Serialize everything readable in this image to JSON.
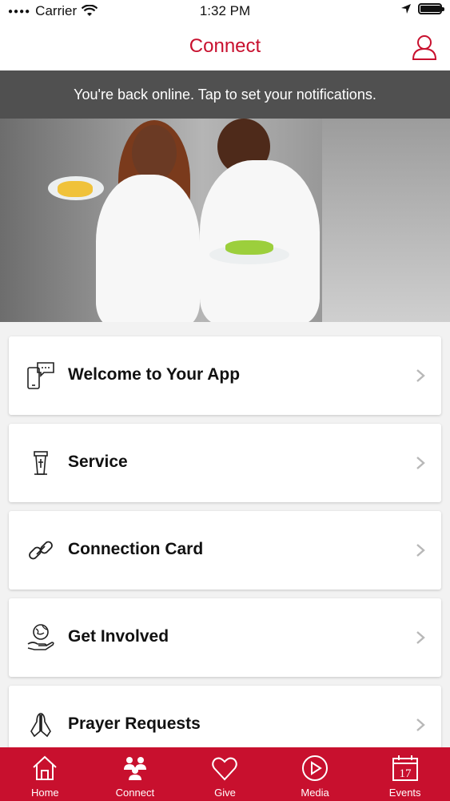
{
  "status_bar": {
    "carrier": "Carrier",
    "time": "1:32 PM"
  },
  "nav": {
    "title": "Connect"
  },
  "banner": {
    "text": "You're back online. Tap to set your notifications."
  },
  "menu": [
    {
      "label": "Welcome to Your App",
      "icon": "chat-phone-icon"
    },
    {
      "label": "Service",
      "icon": "pulpit-icon"
    },
    {
      "label": "Connection Card",
      "icon": "link-icon"
    },
    {
      "label": "Get Involved",
      "icon": "globe-hand-icon"
    },
    {
      "label": "Prayer Requests",
      "icon": "praying-hands-icon"
    }
  ],
  "tabs": [
    {
      "label": "Home",
      "icon": "home-icon"
    },
    {
      "label": "Connect",
      "icon": "people-icon"
    },
    {
      "label": "Give",
      "icon": "heart-icon"
    },
    {
      "label": "Media",
      "icon": "play-icon"
    },
    {
      "label": "Events",
      "icon": "calendar-icon",
      "day": "17"
    }
  ],
  "colors": {
    "brand": "#c8102e",
    "banner_bg": "#505050",
    "background": "#f2f2f2"
  }
}
